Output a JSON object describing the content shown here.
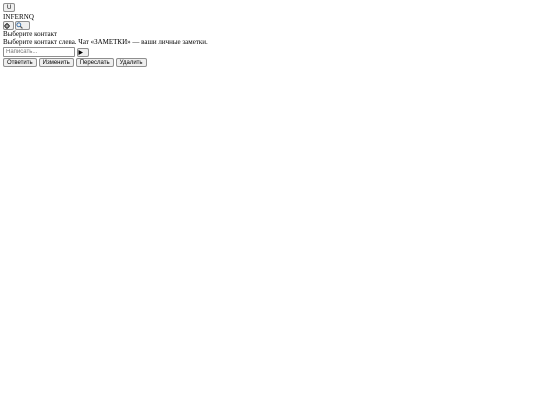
{
  "top_button": {
    "label": "U"
  },
  "brand": {
    "name": "INFERNQ"
  },
  "toolbar": {
    "settings_icon": "gear-icon",
    "search_icon": "magnifier-icon"
  },
  "chat": {
    "title": "Выберите контакт",
    "hint": "Выберите контакт слева. Чат «ЗАМЕТКИ» — ваши личные заметки."
  },
  "composer": {
    "placeholder": "Написать...",
    "value": "",
    "send_icon": "send-arrow-icon"
  },
  "message_actions": [
    {
      "label": "Ответить"
    },
    {
      "label": "Изменить"
    },
    {
      "label": "Переслать"
    },
    {
      "label": "Удалить"
    }
  ]
}
